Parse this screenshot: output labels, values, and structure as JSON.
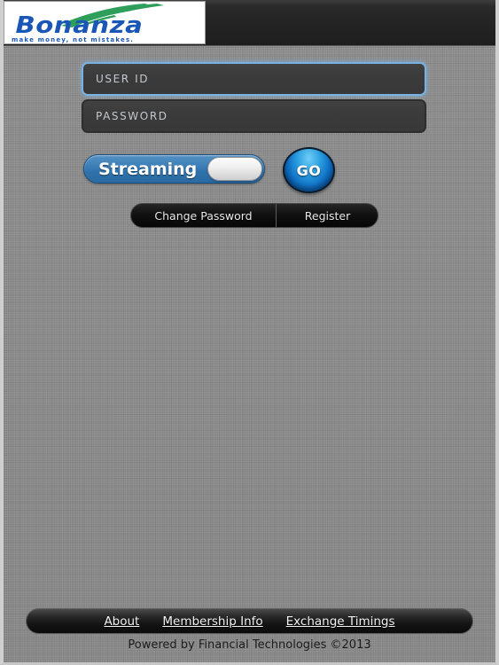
{
  "brand": {
    "name": "Bonanza",
    "tagline": "make money, not mistakes.",
    "swoosh_color": "#2e9e5b",
    "wordmark_color": "#1a56b5"
  },
  "form": {
    "userid": {
      "placeholder": "USER ID",
      "value": "",
      "focused": true,
      "focus_border_color": "#79b2e2"
    },
    "password": {
      "placeholder": "PASSWORD",
      "value": "",
      "focused": false,
      "border_color": "#2e2e2e"
    }
  },
  "toggle": {
    "label": "Streaming",
    "state": "on",
    "track_color": "#2f72ac",
    "knob_color": "#f0f0f0"
  },
  "go_button": {
    "label": "GO",
    "color": "#0f6fc4"
  },
  "segmented": {
    "items": [
      {
        "label": "Change Password"
      },
      {
        "label": "Register"
      }
    ]
  },
  "footer": {
    "links": [
      {
        "label": "About"
      },
      {
        "label": "Membership Info"
      },
      {
        "label": "Exchange Timings"
      }
    ],
    "powered_by": "Powered by Financial Technologies ©2013"
  }
}
